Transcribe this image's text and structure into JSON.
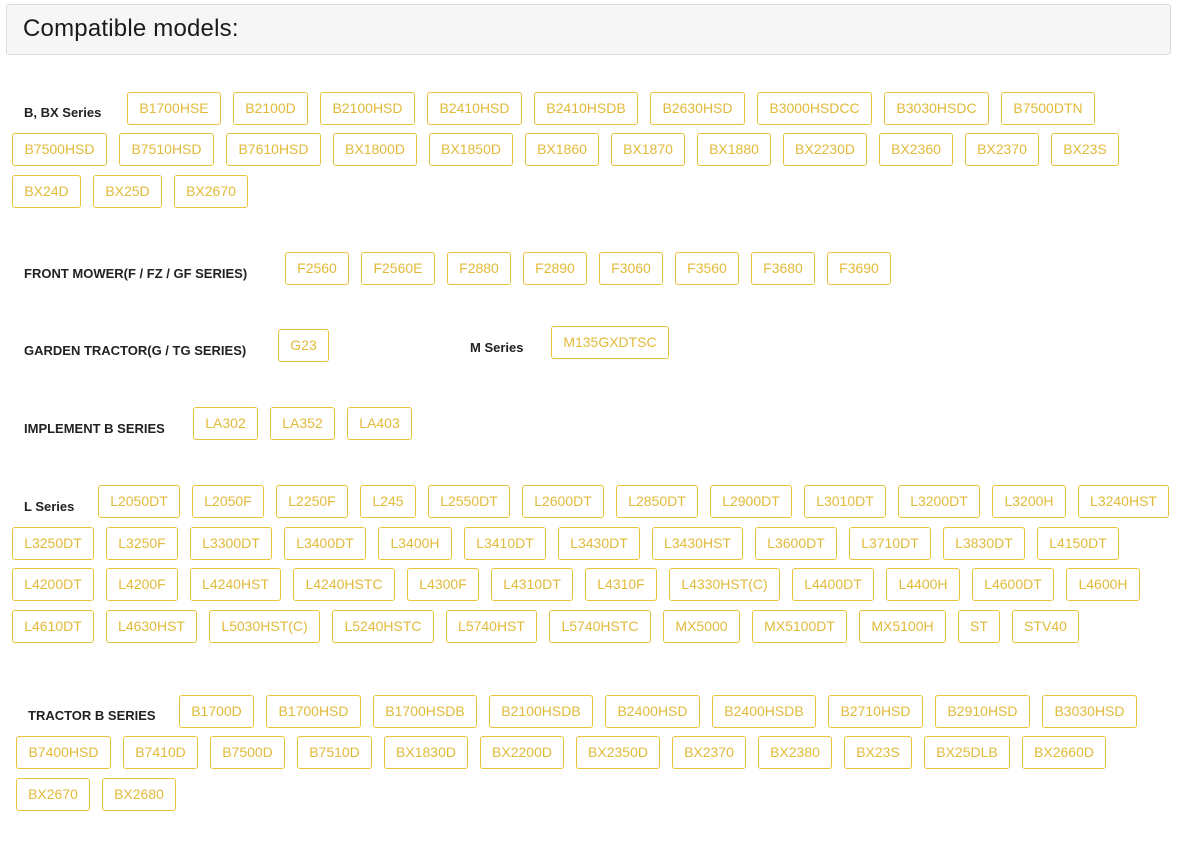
{
  "page": {
    "title": "Compatible models:"
  },
  "accent_color": "#e8c43c",
  "sections": [
    {
      "label": "B, BX Series",
      "models": [
        "B1700HSE",
        "B2100D",
        "B2100HSD",
        "B2410HSD",
        "B2410HSDB",
        "B2630HSD",
        "B3000HSDCC",
        "B3030HSDC",
        "B7500DTN",
        "B7500HSD",
        "B7510HSD",
        "B7610HSD",
        "BX1800D",
        "BX1850D",
        "BX1860",
        "BX1870",
        "BX1880",
        "BX2230D",
        "BX2360",
        "BX2370",
        "BX23S",
        "BX24D",
        "BX25D",
        "BX2670"
      ]
    },
    {
      "label": "FRONT MOWER(F / FZ / GF SERIES)",
      "models": [
        "F2560",
        "F2560E",
        "F2880",
        "F2890",
        "F3060",
        "F3560",
        "F3680",
        "F3690"
      ]
    },
    {
      "label": "GARDEN TRACTOR(G / TG SERIES)",
      "models": [
        "G23"
      ]
    },
    {
      "label": "M Series",
      "models": [
        "M135GXDTSC"
      ]
    },
    {
      "label": "IMPLEMENT B SERIES",
      "models": [
        "LA302",
        "LA352",
        "LA403"
      ]
    },
    {
      "label": "L Series",
      "models": [
        "L2050DT",
        "L2050F",
        "L2250F",
        "L245",
        "L2550DT",
        "L2600DT",
        "L2850DT",
        "L2900DT",
        "L3010DT",
        "L3200DT",
        "L3200H",
        "L3240HST",
        "L3250DT",
        "L3250F",
        "L3300DT",
        "L3400DT",
        "L3400H",
        "L3410DT",
        "L3430DT",
        "L3430HST",
        "L3600DT",
        "L3710DT",
        "L3830DT",
        "L4150DT",
        "L4200DT",
        "L4200F",
        "L4240HST",
        "L4240HSTC",
        "L4300F",
        "L4310DT",
        "L4310F",
        "L4330HST(C)",
        "L4400DT",
        "L4400H",
        "L4600DT",
        "L4600H",
        "L4610DT",
        "L4630HST",
        "L5030HST(C)",
        "L5240HSTC",
        "L5740HST",
        "L5740HSTC",
        "MX5000",
        "MX5100DT",
        "MX5100H",
        "ST",
        "STV40"
      ]
    },
    {
      "label": "TRACTOR B SERIES",
      "models": [
        "B1700D",
        "B1700HSD",
        "B1700HSDB",
        "B2100HSDB",
        "B2400HSD",
        "B2400HSDB",
        "B2710HSD",
        "B2910HSD",
        "B3030HSD",
        "B7400HSD",
        "B7410D",
        "B7500D",
        "B7510D",
        "BX1830D",
        "BX2200D",
        "BX2350D",
        "BX2370",
        "BX2380",
        "BX23S",
        "BX25DLB",
        "BX2660D",
        "BX2670",
        "BX2680"
      ]
    }
  ]
}
